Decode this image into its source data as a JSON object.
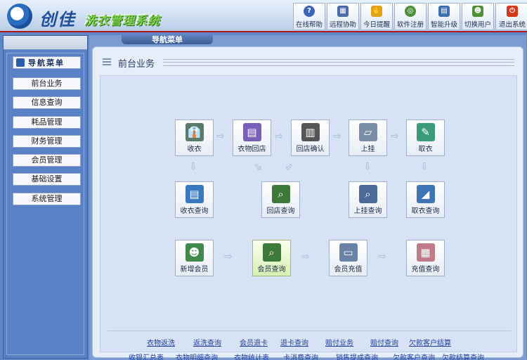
{
  "header": {
    "logo_text": "创佳",
    "app_title": "洗衣管理系统",
    "toolbar": [
      {
        "label": "在线帮助",
        "icon": "help-icon",
        "color": "#3a65b8"
      },
      {
        "label": "远程协助",
        "icon": "remote-assist-icon",
        "color": "#4a6aa8"
      },
      {
        "label": "今日提醒",
        "icon": "reminder-icon",
        "color": "#e0a31a"
      },
      {
        "label": "软件注册",
        "icon": "register-icon",
        "color": "#4f8f3a"
      },
      {
        "label": "智能升级",
        "icon": "upgrade-icon",
        "color": "#3e6fb0"
      },
      {
        "label": "切换用户",
        "icon": "switch-user-icon",
        "color": "#4f8f3a"
      },
      {
        "label": "退出系统",
        "icon": "exit-icon",
        "color": "#d03a1a"
      }
    ]
  },
  "sidebar": {
    "title": "导航菜单",
    "items": [
      "前台业务",
      "信息查询",
      "耗品管理",
      "财务管理",
      "会员管理",
      "基础设置",
      "系统管理"
    ]
  },
  "main": {
    "tab_label": "导航菜单",
    "panel_title": "前台业务",
    "nodes": {
      "receive": "收衣",
      "return_shop": "衣物回店",
      "return_confirm": "回店确认",
      "hang": "上挂",
      "pickup": "取衣",
      "receive_query": "收衣查询",
      "return_query": "回店查询",
      "hang_query": "上挂查询",
      "pickup_query": "取衣查询",
      "add_member": "新增会员",
      "member_query": "会员查询",
      "member_recharge": "会员充值",
      "recharge_query": "充值查询"
    },
    "links_row1": [
      "衣物返洗",
      "返洗查询",
      "会员退卡",
      "退卡查询",
      "赔付业务",
      "赔付查询",
      "欠款客户结算"
    ],
    "links_row2": [
      "收银汇总表",
      "衣物明细查询",
      "衣物统计表",
      "卡消费查询",
      "销售提成查询",
      "欠款客户查询",
      "欠款结算查询"
    ]
  },
  "colors": {
    "accent": "#5b80c4",
    "header_border": "#b01818",
    "link": "#2540a0"
  }
}
